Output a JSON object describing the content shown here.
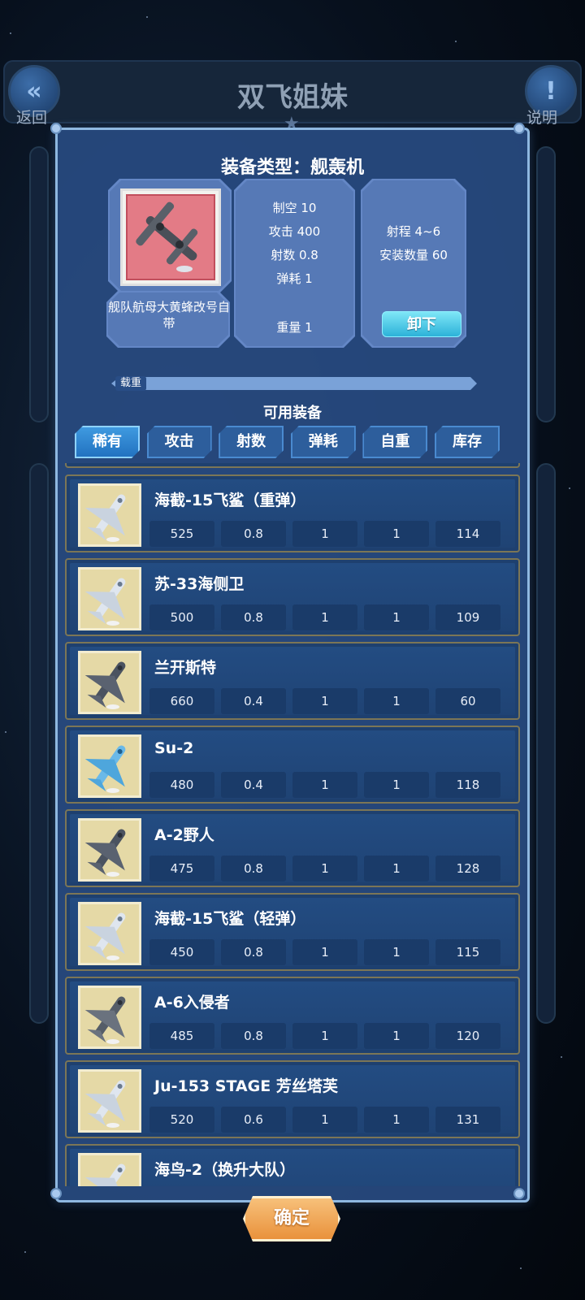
{
  "header": {
    "back_label": "返回",
    "page_title": "双飞姐妹",
    "help_label": "说明"
  },
  "modal": {
    "title": "装备类型：舰轰机",
    "equipped": {
      "name": "舰队航母大黄蜂改号自带",
      "stats_left": [
        "制空 10",
        "攻击 400",
        "射数 0.8",
        "弹耗 1"
      ],
      "weight": "重量 1",
      "stats_right": [
        "射程 4~6",
        "安装数量 60"
      ],
      "unload_label": "卸下"
    },
    "load_label": "载重",
    "available_title": "可用装备",
    "tabs": [
      {
        "label": "稀有",
        "active": true
      },
      {
        "label": "攻击",
        "active": false
      },
      {
        "label": "射数",
        "active": false
      },
      {
        "label": "弹耗",
        "active": false
      },
      {
        "label": "自重",
        "active": false
      },
      {
        "label": "库存",
        "active": false
      }
    ],
    "items": [
      {
        "name": "海截-15飞鲨（重弹）",
        "values": [
          "525",
          "0.8",
          "1",
          "1",
          "114"
        ],
        "icon": "jet-fighter-icon"
      },
      {
        "name": "苏-33海侧卫",
        "values": [
          "500",
          "0.8",
          "1",
          "1",
          "109"
        ],
        "icon": "jet-fighter-icon"
      },
      {
        "name": "兰开斯特",
        "values": [
          "660",
          "0.4",
          "1",
          "1",
          "60"
        ],
        "icon": "bomber-icon"
      },
      {
        "name": "Su-2",
        "values": [
          "480",
          "0.4",
          "1",
          "1",
          "118"
        ],
        "icon": "prop-plane-icon"
      },
      {
        "name": "A-2野人",
        "values": [
          "475",
          "0.8",
          "1",
          "1",
          "128"
        ],
        "icon": "bomber-icon"
      },
      {
        "name": "海截-15飞鲨（轻弹）",
        "values": [
          "450",
          "0.8",
          "1",
          "1",
          "115"
        ],
        "icon": "jet-fighter-icon"
      },
      {
        "name": "A-6入侵者",
        "values": [
          "485",
          "0.8",
          "1",
          "1",
          "120"
        ],
        "icon": "jet-bomber-icon"
      },
      {
        "name": "Ju-153 STAGE 芳丝塔芙",
        "values": [
          "520",
          "0.6",
          "1",
          "1",
          "131"
        ],
        "icon": "jet-fighter-icon"
      },
      {
        "name": "海鸟-2（换升大队）",
        "values": [
          "",
          "",
          "",
          "",
          ""
        ],
        "icon": "plane-icon"
      }
    ],
    "confirm_label": "确定"
  },
  "colors": {
    "modal_bg": "#284a80",
    "row_border": "#7c7656",
    "tab_active": "#3f9ae0",
    "confirm": "#e9923c",
    "unload": "#2cb2d9"
  }
}
